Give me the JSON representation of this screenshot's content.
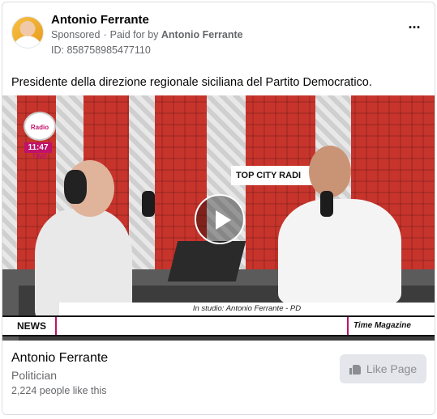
{
  "post": {
    "author": "Antonio Ferrante",
    "sponsored": "Sponsored",
    "paid_for_prefix": "Paid for by",
    "paid_for_name": "Antonio Ferrante",
    "ad_id": "ID: 858758985477110",
    "text": "Presidente della direzione regionale siciliana del Partito Democratico."
  },
  "video": {
    "channel_logo": "Radio TIME",
    "clock": "11:47",
    "studio_sign": "TOP CITY RADI",
    "caption": "In studio: Antonio Ferrante - PD",
    "ticker_label": "NEWS",
    "ticker_brand": "Time Magazine",
    "play_icon": "play-icon"
  },
  "page": {
    "name": "Antonio Ferrante",
    "category": "Politician",
    "likes": "2,224 people like this",
    "like_button": "Like Page"
  },
  "colors": {
    "link_blue": "#1877f2",
    "secondary_text": "#65676b",
    "button_bg": "#e4e6eb",
    "brand_magenta": "#c0116b"
  }
}
